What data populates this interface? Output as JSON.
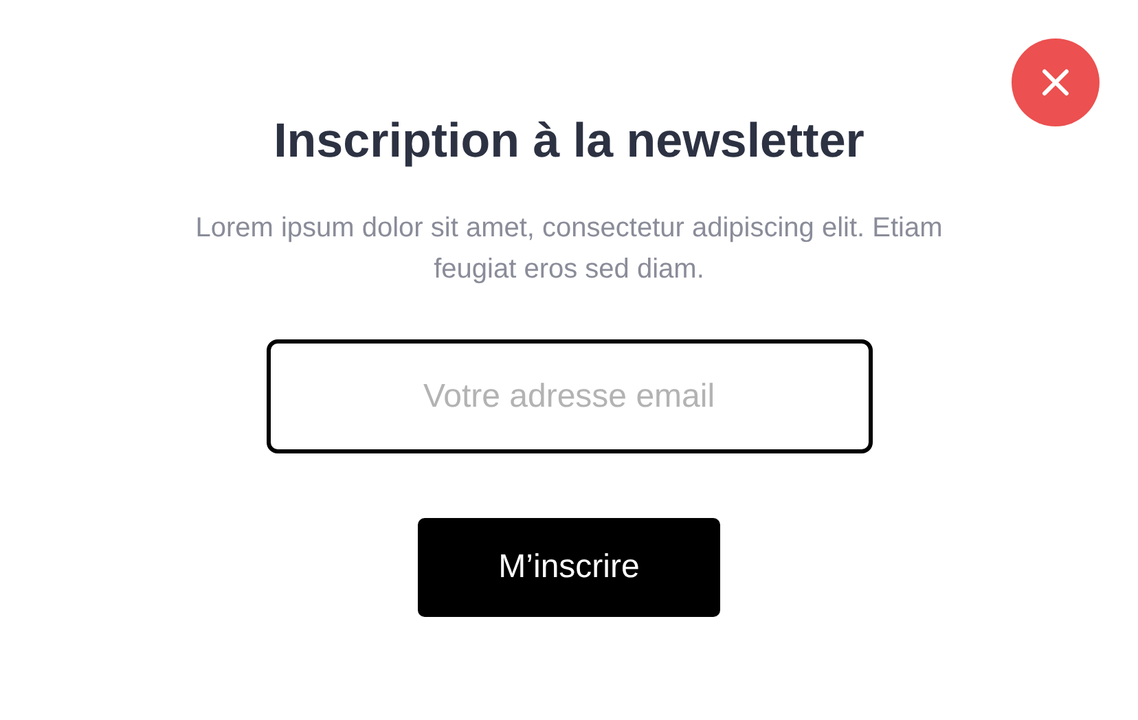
{
  "title": "Inscription à la newsletter",
  "description": "Lorem ipsum dolor sit amet, consectetur adipiscing elit. Etiam feugiat eros sed diam.",
  "email_field": {
    "placeholder": "Votre adresse email"
  },
  "submit_button": "M’inscrire"
}
